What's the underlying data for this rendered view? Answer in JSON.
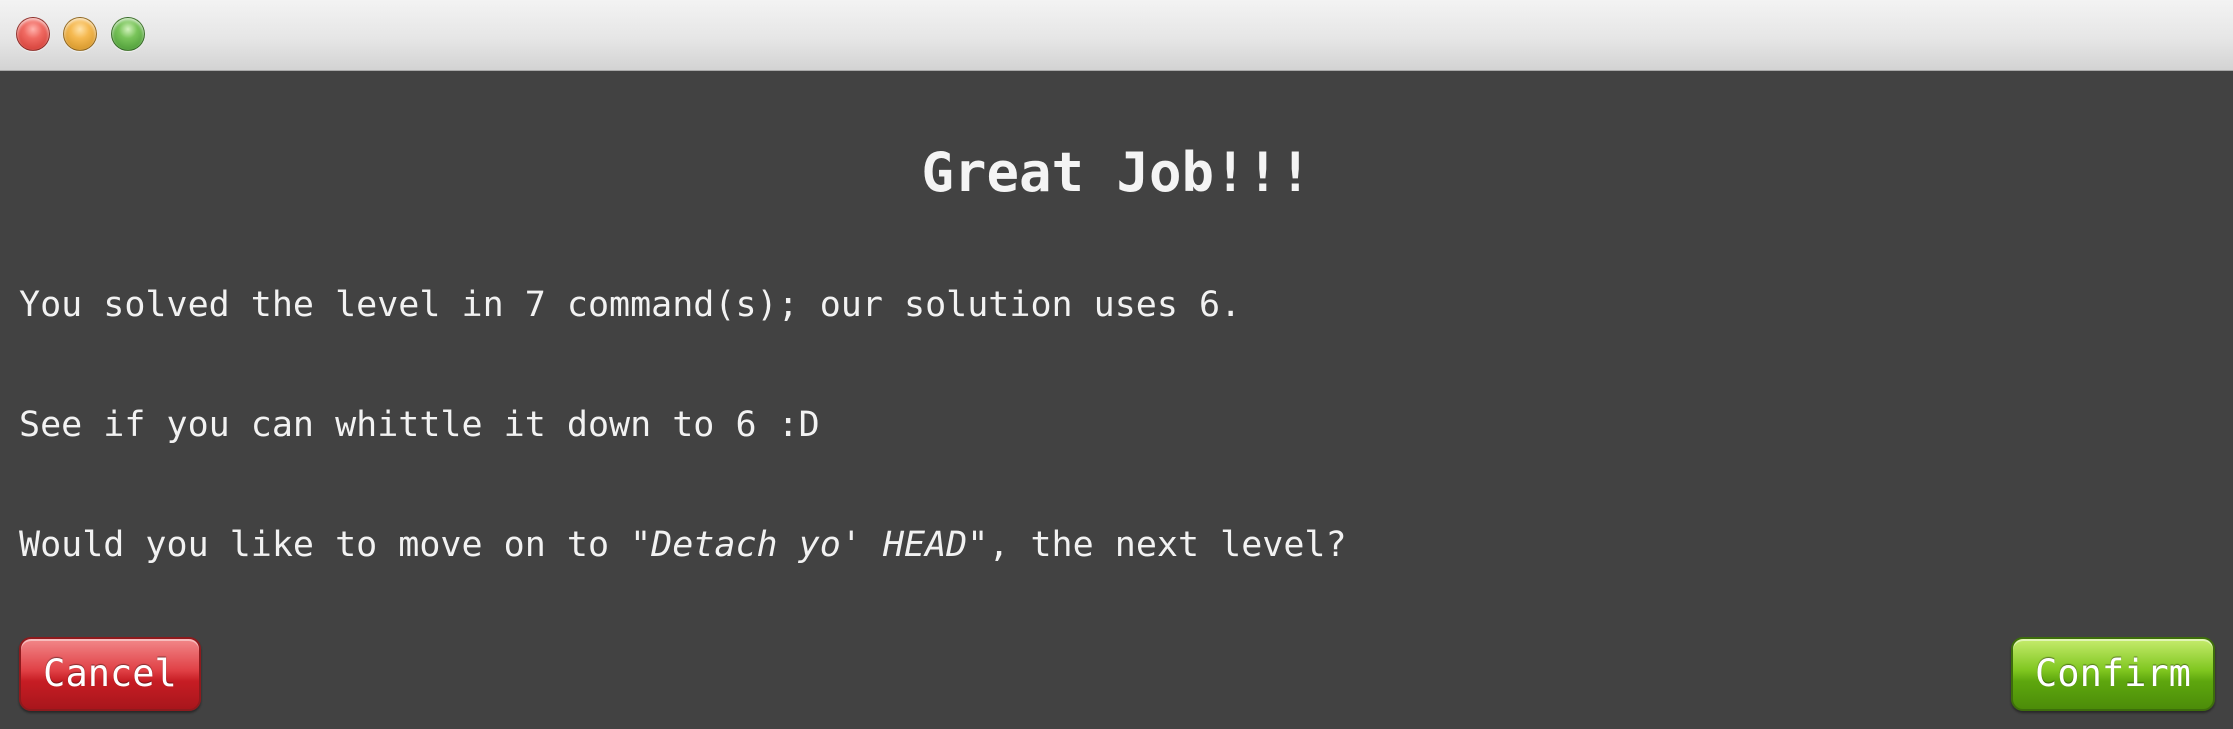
{
  "window": {
    "controls": {
      "close_icon": "red-traffic-light-icon",
      "minimize_icon": "yellow-traffic-light-icon",
      "zoom_icon": "green-traffic-light-icon"
    }
  },
  "dialog": {
    "title": "Great Job!!!",
    "line1": "You solved the level in 7 command(s); our solution uses 6.",
    "line2": "See if you can whittle it down to 6 :D",
    "line3_prefix": "Would you like to move on to ",
    "next_level_name": "\"Detach yo' HEAD\"",
    "line3_suffix": ", the next level?"
  },
  "buttons": {
    "cancel_label": "Cancel",
    "confirm_label": "Confirm"
  },
  "colors": {
    "background": "#424242",
    "text": "#f2f2f2",
    "cancel": "#d6282e",
    "confirm": "#6db514"
  }
}
